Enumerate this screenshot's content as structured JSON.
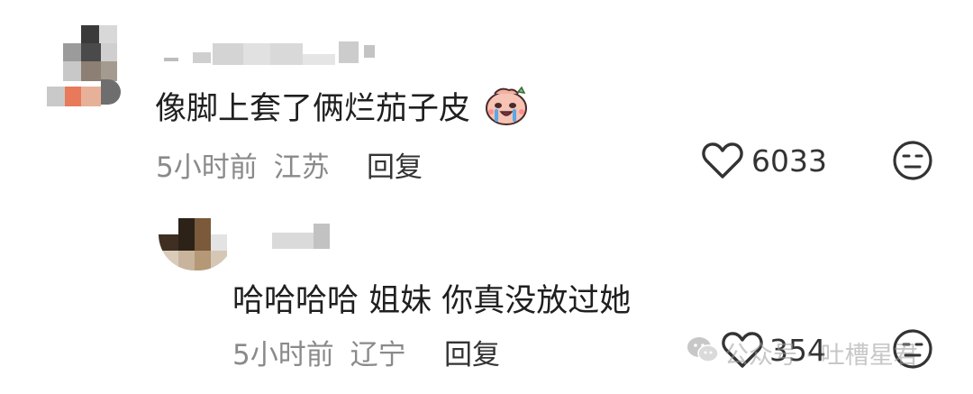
{
  "comments": [
    {
      "text": "像脚上套了俩烂茄子皮",
      "emoji": "crying-face-sticker",
      "time": "5小时前",
      "location": "江苏",
      "reply_label": "回复",
      "likes": "6033"
    },
    {
      "text": "哈哈哈哈 姐妹 你真没放过她",
      "time": "5小时前",
      "location": "辽宁",
      "reply_label": "回复",
      "likes": "354"
    }
  ],
  "watermark": {
    "text": "公众号 · 吐槽星君"
  },
  "icons": {
    "like": "heart-outline-icon",
    "dislike": "meh-face-icon",
    "watermark": "wechat-icon"
  },
  "colors": {
    "text": "#1f1f1f",
    "meta": "#8a8a8a",
    "icon": "#333333"
  }
}
